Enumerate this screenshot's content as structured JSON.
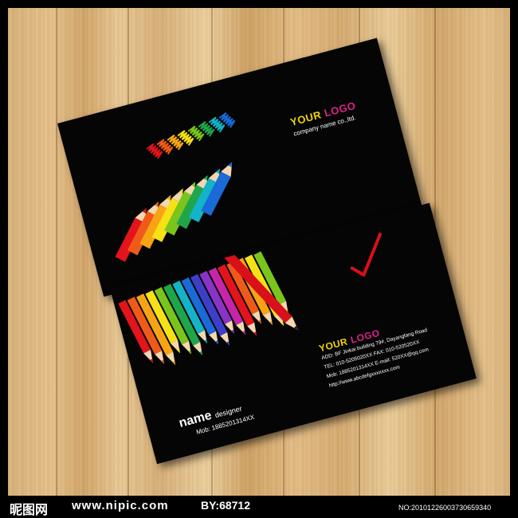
{
  "front_card": {
    "logo_your": "YOUR",
    "logo_logo": "LOGO",
    "company": "company name co.,ltd."
  },
  "back_card": {
    "name": "name",
    "title": "designer",
    "mobile": "Mob: 1885201314XX",
    "logo_your": "YOUR",
    "logo_logo": "LOGO",
    "address": "ADD: BF Jinkai building 79#, Dayangfang Road",
    "tel_fax": "TEL: 010-5205020XX  FAX: 010-520520XX",
    "mob_email": "Mob: 1885201314XX  E-mail: 520XX@qq.com",
    "website": "http://www.abcdefgxxxxxxx.com"
  },
  "watermark": {
    "brand": "昵图网",
    "site": "www.nipic.com",
    "by": "BY:68712",
    "number": "NO:20101226003730659340"
  },
  "colors": {
    "logo_your": "#f3d400",
    "logo_logo": "#e0218a",
    "pencil_spectrum": [
      "#e3141c",
      "#f05a18",
      "#f7a414",
      "#f5e116",
      "#7ac51c",
      "#1fa64a",
      "#14b3c8",
      "#1a6ad8",
      "#3d3fc9",
      "#8a33c7",
      "#c526a9"
    ],
    "checkmark": "#d8101a"
  }
}
